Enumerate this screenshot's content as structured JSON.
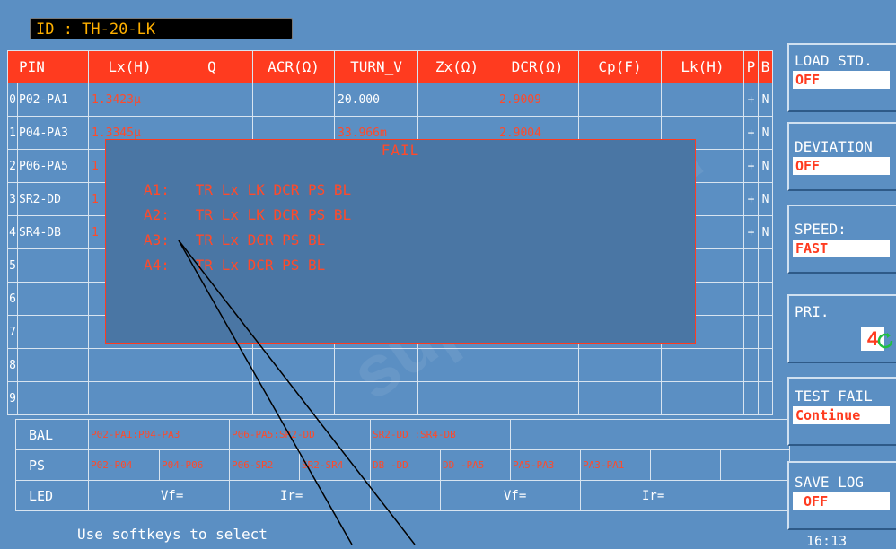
{
  "id_bar": {
    "text": "ID : TH-20-LK"
  },
  "table": {
    "headers": [
      "PIN",
      "Lx(H)",
      "Q",
      "ACR(Ω)",
      "TURN_V",
      "Zx(Ω)",
      "DCR(Ω)",
      "Cp(F)",
      "Lk(H)",
      "P",
      "B"
    ],
    "rows": [
      {
        "idx": "0",
        "pin": "P02-PA1",
        "lx": "1.3423μ",
        "turn_v": "20.000",
        "dcr": "2.9009",
        "p": "+",
        "b": "N"
      },
      {
        "idx": "1",
        "pin": "P04-PA3",
        "lx": "1.3345μ",
        "turn_v": "33.966m",
        "dcr": "2.9004",
        "p": "+",
        "b": "N"
      },
      {
        "idx": "2",
        "pin": "P06-PA5",
        "lx": "1",
        "turn_v": "",
        "dcr": "",
        "p": "+",
        "b": "N"
      },
      {
        "idx": "3",
        "pin": "SR2-DD",
        "lx": "1",
        "turn_v": "",
        "dcr": "",
        "p": "+",
        "b": "N"
      },
      {
        "idx": "4",
        "pin": "SR4-DB",
        "lx": "1",
        "turn_v": "",
        "dcr": "",
        "p": "+",
        "b": "N"
      },
      {
        "idx": "5",
        "pin": "",
        "lx": "",
        "turn_v": "",
        "dcr": "",
        "p": "",
        "b": ""
      },
      {
        "idx": "6",
        "pin": "",
        "lx": "",
        "turn_v": "",
        "dcr": "",
        "p": "",
        "b": ""
      },
      {
        "idx": "7",
        "pin": "",
        "lx": "",
        "turn_v": "",
        "dcr": "",
        "p": "",
        "b": ""
      },
      {
        "idx": "8",
        "pin": "",
        "lx": "",
        "turn_v": "",
        "dcr": "",
        "p": "",
        "b": ""
      },
      {
        "idx": "9",
        "pin": "",
        "lx": "",
        "turn_v": "",
        "dcr": "",
        "p": "",
        "b": ""
      }
    ]
  },
  "bal": {
    "label": "BAL",
    "cells": [
      "P02-PA1:P04-PA3",
      "P06-PA5:SR2-DD",
      "SR2-DD :SR4-DB"
    ]
  },
  "ps": {
    "label": "PS",
    "cells": [
      "P02-P04",
      "P04-P06",
      "P06-SR2",
      "SR2-SR4",
      "DB -DD",
      "DD -PA5",
      "PA5-PA3",
      "PA3-PA1"
    ]
  },
  "led": {
    "label": "LED",
    "vf1": "Vf=",
    "ir1": "Ir=",
    "vf2": "Vf=",
    "ir2": "Ir="
  },
  "fail_dialog": {
    "title": "FAIL",
    "lines": [
      "A1:   TR Lx LK DCR PS BL",
      "A2:   TR Lx LK DCR PS BL",
      "A3:   TR Lx DCR PS BL",
      "A4:   TR Lx DCR PS BL"
    ]
  },
  "softkeys": [
    {
      "label": "LOAD STD.",
      "value": "OFF"
    },
    {
      "label": "DEVIATION",
      "value": "OFF"
    },
    {
      "label": "SPEED:",
      "value": "FAST"
    },
    {
      "label": "PRI.",
      "value": "4",
      "icon": "refresh-icon"
    },
    {
      "label": "TEST FAIL",
      "value": "Continue"
    },
    {
      "label": "SAVE LOG",
      "value": " OFF"
    }
  ],
  "status": {
    "message": "Use softkeys to select",
    "clock": "16:13"
  },
  "colors": {
    "background": "#5b8fc3",
    "header_red": "#ff3b1f",
    "value_red": "#ff4a2a"
  }
}
